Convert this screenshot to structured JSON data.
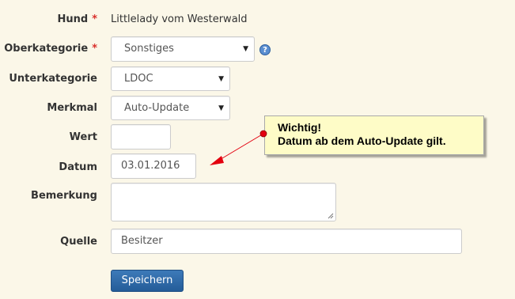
{
  "form": {
    "hund": {
      "label": "Hund",
      "required_mark": "*",
      "value": "Littlelady vom Westerwald"
    },
    "oberkategorie": {
      "label": "Oberkategorie",
      "required_mark": "*",
      "selected": "Sonstiges",
      "help_icon": "question-icon",
      "help_glyph": "?"
    },
    "unterkategorie": {
      "label": "Unterkategorie",
      "selected": "LDOC"
    },
    "merkmal": {
      "label": "Merkmal",
      "selected": "Auto-Update"
    },
    "wert": {
      "label": "Wert",
      "value": ""
    },
    "datum": {
      "label": "Datum",
      "value": "03.01.2016"
    },
    "bemerkung": {
      "label": "Bemerkung",
      "value": ""
    },
    "quelle": {
      "label": "Quelle",
      "value": "Besitzer"
    },
    "submit_label": "Speichern"
  },
  "callout": {
    "line1": "Wichtig!",
    "line2": "Datum ab dem Auto-Update gilt."
  },
  "colors": {
    "background": "#fbf7e8",
    "required": "#d9302c",
    "button": "#2a65a3",
    "callout_bg": "#fefcc7",
    "arrow": "#e3000f"
  },
  "icons": {
    "dropdown": "triangle-down-icon"
  }
}
